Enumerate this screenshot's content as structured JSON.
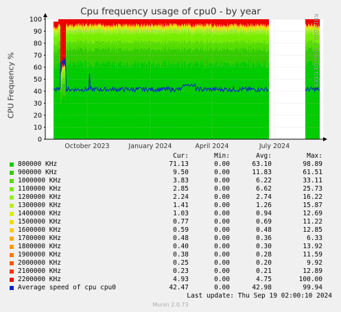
{
  "title": "Cpu frequency usage of cpu0 - by year",
  "side_label": "RRDTOOL / TOBI OETIKER",
  "footer": "Munin 2.0.73",
  "last_update": "Last update: Thu Sep 19 02:00:10 2024",
  "legend_headers": {
    "cur": "Cur:",
    "min": "Min:",
    "avg": "Avg:",
    "max": "Max:"
  },
  "chart_data": {
    "type": "area",
    "ylabel": "CPU Frequency %",
    "ylim": [
      0,
      100
    ],
    "yticks": [
      0,
      10,
      20,
      30,
      40,
      50,
      60,
      70,
      80,
      90,
      100
    ],
    "xticks": [
      "October 2023",
      "January 2024",
      "April 2024",
      "July 2024"
    ],
    "grid": true,
    "stack_description": "stacked frequency shares (green 800000 KHz at bottom, red 2200000 KHz at top); data gap in late July to early September 2024",
    "series": [
      {
        "name": "800000 KHz",
        "color": "#00cc00",
        "cur": "71.13",
        "min": "0.00",
        "avg": "63.10",
        "max": "98.89"
      },
      {
        "name": "900000 KHz",
        "color": "#33cc00",
        "cur": "9.50",
        "min": "0.00",
        "avg": "11.83",
        "max": "61.51"
      },
      {
        "name": "1000000 KHz",
        "color": "#55dd00",
        "cur": "3.83",
        "min": "0.00",
        "avg": "6.22",
        "max": "33.11"
      },
      {
        "name": "1100000 KHz",
        "color": "#77ee00",
        "cur": "2.85",
        "min": "0.00",
        "avg": "6.62",
        "max": "25.73"
      },
      {
        "name": "1200000 KHz",
        "color": "#99ee22",
        "cur": "2.24",
        "min": "0.00",
        "avg": "2.74",
        "max": "16.22"
      },
      {
        "name": "1300000 KHz",
        "color": "#bbee22",
        "cur": "1.41",
        "min": "0.00",
        "avg": "1.26",
        "max": "15.87"
      },
      {
        "name": "1400000 KHz",
        "color": "#ddee00",
        "cur": "1.03",
        "min": "0.00",
        "avg": "0.94",
        "max": "12.69"
      },
      {
        "name": "1500000 KHz",
        "color": "#eedd00",
        "cur": "0.77",
        "min": "0.00",
        "avg": "0.69",
        "max": "11.22"
      },
      {
        "name": "1600000 KHz",
        "color": "#ffcc00",
        "cur": "0.59",
        "min": "0.00",
        "avg": "0.48",
        "max": "12.85"
      },
      {
        "name": "1700000 KHz",
        "color": "#ffaa00",
        "cur": "0.48",
        "min": "0.00",
        "avg": "0.36",
        "max": "6.33"
      },
      {
        "name": "1800000 KHz",
        "color": "#ff9900",
        "cur": "0.40",
        "min": "0.00",
        "avg": "0.30",
        "max": "13.92"
      },
      {
        "name": "1900000 KHz",
        "color": "#ff7700",
        "cur": "0.38",
        "min": "0.00",
        "avg": "0.28",
        "max": "11.59"
      },
      {
        "name": "2000000 KHz",
        "color": "#ff5500",
        "cur": "0.25",
        "min": "0.00",
        "avg": "0.20",
        "max": "9.92"
      },
      {
        "name": "2100000 KHz",
        "color": "#ff3300",
        "cur": "0.23",
        "min": "0.00",
        "avg": "0.21",
        "max": "12.89"
      },
      {
        "name": "2200000 KHz",
        "color": "#ee0000",
        "cur": "4.93",
        "min": "0.00",
        "avg": "4.75",
        "max": "100.00"
      },
      {
        "name": "Average speed of cpu cpu0",
        "color": "#0022cc",
        "cur": "42.47",
        "min": "0.00",
        "avg": "42.98",
        "max": "99.94",
        "line": true
      }
    ]
  }
}
